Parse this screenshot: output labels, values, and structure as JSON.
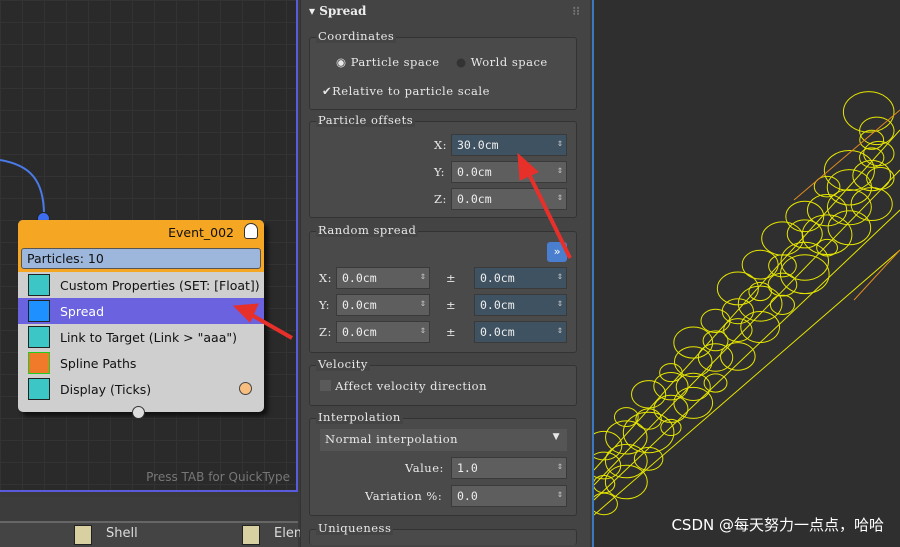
{
  "node_editor": {
    "hint": "Press TAB for QuickType",
    "event": {
      "title": "Event_002",
      "particles": "Particles: 10",
      "operators": [
        {
          "label": "Custom Properties (SET: [Float])",
          "color": "#3cc6c6"
        },
        {
          "label": "Spread",
          "color": "#1e90ff"
        },
        {
          "label": "Link to Target (Link > \"aaa\")",
          "color": "#3cc6c6"
        },
        {
          "label": "Spline Paths",
          "color": "#f07a2a"
        },
        {
          "label": "Display (Ticks)",
          "color": "#3cc6c6"
        }
      ]
    }
  },
  "bottom_bar": {
    "items": [
      "Shell",
      "Elem"
    ]
  },
  "panel": {
    "rollout": "Spread",
    "coordinates": {
      "label": "Coordinates",
      "radio1": "Particle space",
      "radio2": "World space",
      "check": "Relative to particle scale"
    },
    "offsets": {
      "label": "Particle offsets",
      "x_label": "X:",
      "x": "30.0cm",
      "y_label": "Y:",
      "y": "0.0cm",
      "z_label": "Z:",
      "z": "0.0cm"
    },
    "random": {
      "label": "Random spread",
      "btn": "»",
      "pm": "±",
      "rows": [
        {
          "axis": "X:",
          "v": "0.0cm",
          "r": "0.0cm"
        },
        {
          "axis": "Y:",
          "v": "0.0cm",
          "r": "0.0cm"
        },
        {
          "axis": "Z:",
          "v": "0.0cm",
          "r": "0.0cm"
        }
      ]
    },
    "velocity": {
      "label": "Velocity",
      "check": "Affect velocity direction"
    },
    "interp": {
      "label": "Interpolation",
      "mode": "Normal interpolation",
      "value_label": "Value:",
      "value": "1.0",
      "var_label": "Variation %:",
      "var": "0.0"
    },
    "uniqueness": {
      "label": "Uniqueness"
    }
  },
  "watermark": "CSDN @每天努力一点点，哈哈",
  "colors": {
    "accent": "#6a62de",
    "node_header": "#f5a623",
    "arrow": "#e8302a",
    "wire": "#e6e600"
  }
}
